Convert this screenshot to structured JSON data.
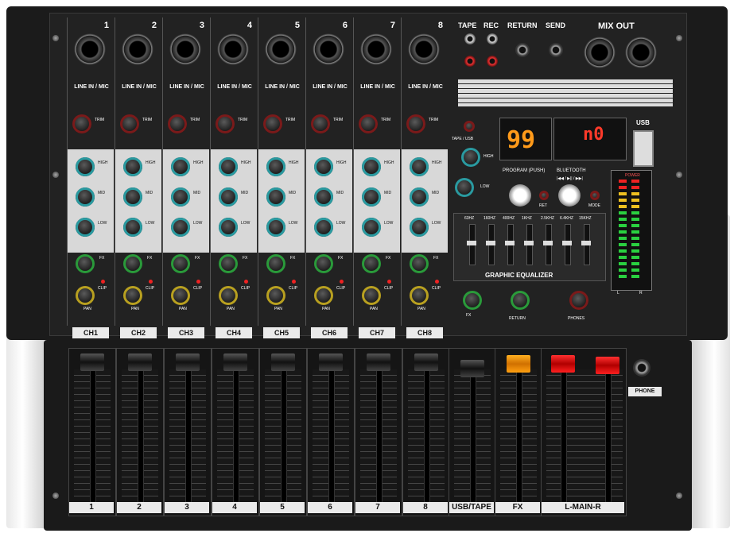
{
  "channels": {
    "numbers": [
      "1",
      "2",
      "3",
      "4",
      "5",
      "6",
      "7",
      "8"
    ],
    "input_label": "LINE IN / MIC",
    "knob_labels": {
      "trim": "TRIM",
      "high": "HIGH",
      "mid": "MID",
      "low": "LOW",
      "fx": "FX",
      "pan": "PAN",
      "clip": "CLIP"
    },
    "buttons": [
      "CH1",
      "CH2",
      "CH3",
      "CH4",
      "CH5",
      "CH6",
      "CH7",
      "CH8"
    ]
  },
  "io": {
    "tape": "TAPE",
    "rec": "REC",
    "return": "RETURN",
    "send": "SEND",
    "mix_out": "MIX OUT",
    "l": "L",
    "r": "R"
  },
  "display": {
    "left_value": "99",
    "right_value": "n0",
    "usb": "USB"
  },
  "controls": {
    "tape_usb": "TAPE / USB",
    "high": "HIGH",
    "low": "LOW",
    "program": "PROGRAM (PUSH)",
    "bluetooth": "BLUETOOTH",
    "transport": "|◀◀ / ▶|| / ▶▶|",
    "ret": "RET",
    "mode": "MODE",
    "graphic_eq": "GRAPHIC EQUALIZER",
    "eq_bands": [
      "63HZ",
      "160HZ",
      "400HZ",
      "1KHZ",
      "2.5KHZ",
      "6.4KHZ",
      "15KHZ"
    ],
    "fx": "FX",
    "return": "RETURN",
    "phones": "PHONES",
    "power": "POWER",
    "clip": "CLIP",
    "meter_l": "L",
    "meter_r": "R"
  },
  "faders": {
    "labels": [
      "1",
      "2",
      "3",
      "4",
      "5",
      "6",
      "7",
      "8",
      "USB/TAPE",
      "FX",
      "L-MAIN-R"
    ],
    "phone": "PHONE"
  }
}
